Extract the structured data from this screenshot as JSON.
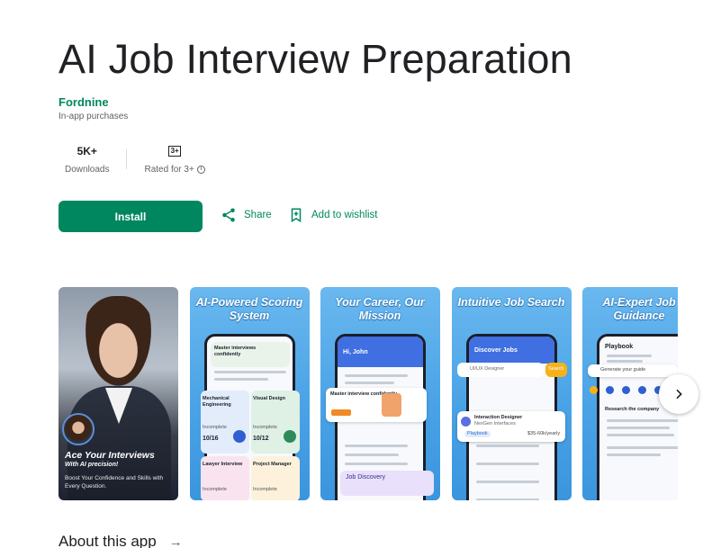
{
  "app": {
    "title": "AI Job Interview Preparation",
    "developer": "Fordnine",
    "in_app": "In-app purchases"
  },
  "stats": {
    "downloads_value": "5K+",
    "downloads_label": "Downloads",
    "rating_badge": "3+",
    "rating_label": "Rated for 3+"
  },
  "actions": {
    "install": "Install",
    "share": "Share",
    "wishlist": "Add to wishlist"
  },
  "screenshots": {
    "s1_title": "Ace Your Interviews",
    "s1_sub": "With AI precision!",
    "s1_body": "Boost Your Confidence and Skills with Every Question.",
    "s2_title": "AI-Powered Scoring System",
    "s3_title": "Your Career, Our Mission",
    "s4_title": "Intuitive Job Search",
    "s5_title": "AI-Expert Job Guidance",
    "s2_card1": "Master interviews confidently",
    "s2_card2": "Mechanical Engineering",
    "s2_card3": "Visual Design",
    "s2_card4": "Lawyer Interview",
    "s2_card5": "Project Manager",
    "s2_score1": "10/16",
    "s2_score2": "10/12",
    "s2_incomplete": "Incomplete",
    "s3_greeting": "Hi, John",
    "s3_card": "Master interview confidently",
    "s3_discovery": "Job Discovery",
    "s4_header": "Discover Jobs",
    "s4_search": "UI/UX Designer",
    "s4_search_btn": "Search",
    "s4_job1": "Interaction Designer",
    "s4_job1_sub": "NexGen Interfaces",
    "s4_job1_badge": "Playbook",
    "s4_job1_salary": "$35-60k/yearly",
    "s5_header": "Playbook",
    "s5_generate": "Generate your guide",
    "s5_research": "Research the company"
  },
  "about": {
    "label": "About this app",
    "arrow": "→"
  },
  "colors": {
    "brand_green": "#01875f",
    "text": "#202124",
    "muted": "#5f6368"
  }
}
